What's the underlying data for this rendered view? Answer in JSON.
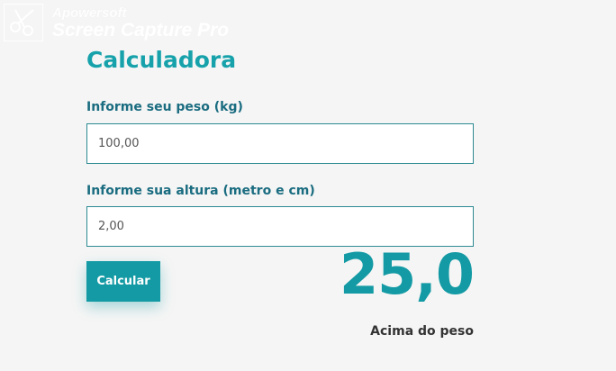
{
  "watermark": {
    "line1": "Apowersoft",
    "line2": "Screen Capture Pro"
  },
  "calculator": {
    "title": "Calculadora",
    "weight_label": "Informe seu peso (kg)",
    "weight_value": "100,00",
    "height_label": "Informe sua altura (metro e cm)",
    "height_value": "2,00",
    "calculate_label": "Calcular",
    "result_value": "25,0",
    "result_status": "Acima do peso"
  },
  "colors": {
    "accent": "#139aa4",
    "label": "#1a6c80",
    "background": "#f5f5f5"
  }
}
